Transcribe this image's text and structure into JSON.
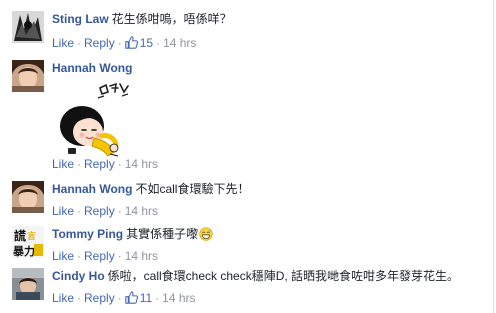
{
  "action_labels": {
    "like": "Like",
    "reply": "Reply",
    "sep": "·"
  },
  "comments": [
    {
      "author": "Sting Law",
      "text": "花生係咁嗚，唔係咩？",
      "likes": "15",
      "time": "14 hrs"
    },
    {
      "author": "Hannah Wong",
      "text": "",
      "likes": "",
      "time": "14 hrs"
    },
    {
      "author": "Hannah Wong",
      "text": "不如call食環驗下先！",
      "likes": "",
      "time": "14 hrs"
    },
    {
      "author": "Tommy Ping",
      "text": "其實係種子嚟",
      "likes": "",
      "time": "14 hrs"
    },
    {
      "author": "Cindy Ho",
      "text": "係啦，call食環check check穩陣D, 話晒我哋食咗咁多年發芽花生。",
      "likes": "11",
      "time": "14 hrs"
    }
  ],
  "avatar_badge": {
    "line1": "謊",
    "line2": "暴力",
    "side": "言"
  },
  "colors": {
    "author": "#365899",
    "link": "#4267b2",
    "meta": "#90949c",
    "text": "#1d2129"
  }
}
